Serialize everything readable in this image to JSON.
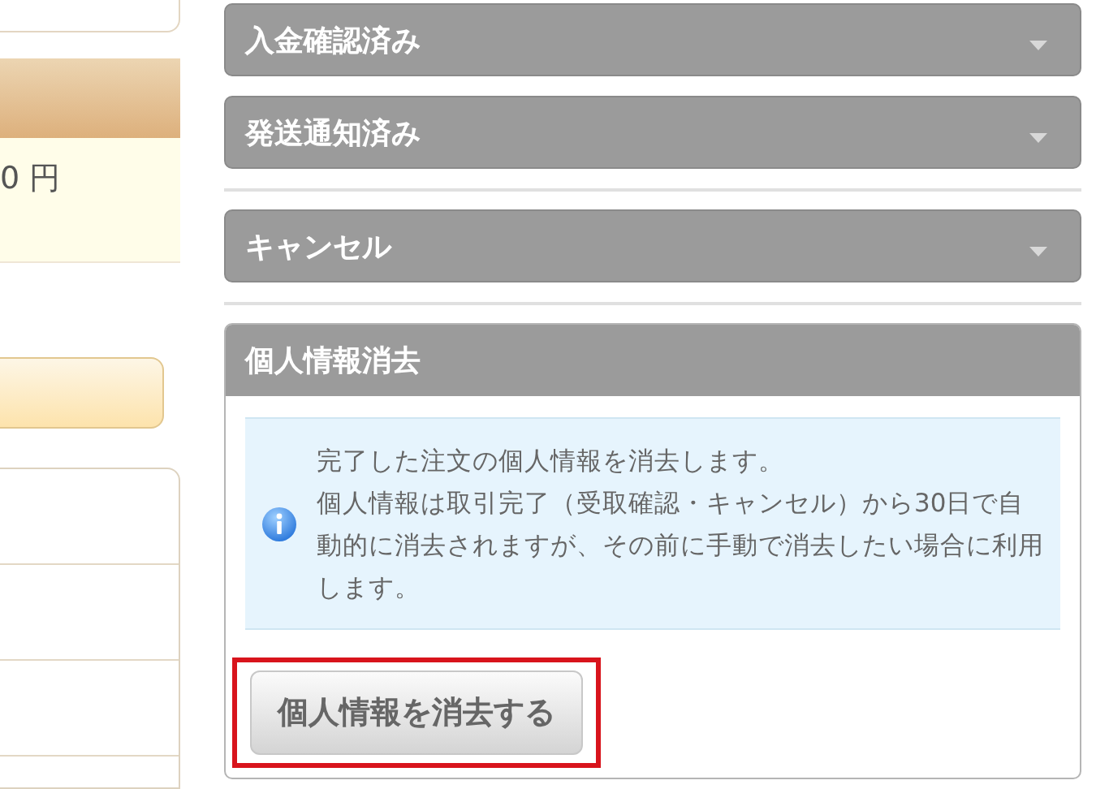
{
  "left_column": {
    "price": "0 円"
  },
  "sections": [
    {
      "title": "入金確認済み",
      "expanded": false,
      "divider_after": false
    },
    {
      "title": "発送通知済み",
      "expanded": false,
      "divider_after": true
    },
    {
      "title": "キャンセル",
      "expanded": false,
      "divider_after": true
    },
    {
      "title": "個人情報消去",
      "expanded": true,
      "divider_after": false,
      "notice": [
        "完了した注文の個人情報を消去します。",
        "個人情報は取引完了（受取確認・キャンセル）から30日で自動的に消去されますが、その前に手動で消去したい場合に利用します。"
      ],
      "button": "個人情報を消去する",
      "button_highlighted": true
    }
  ]
}
